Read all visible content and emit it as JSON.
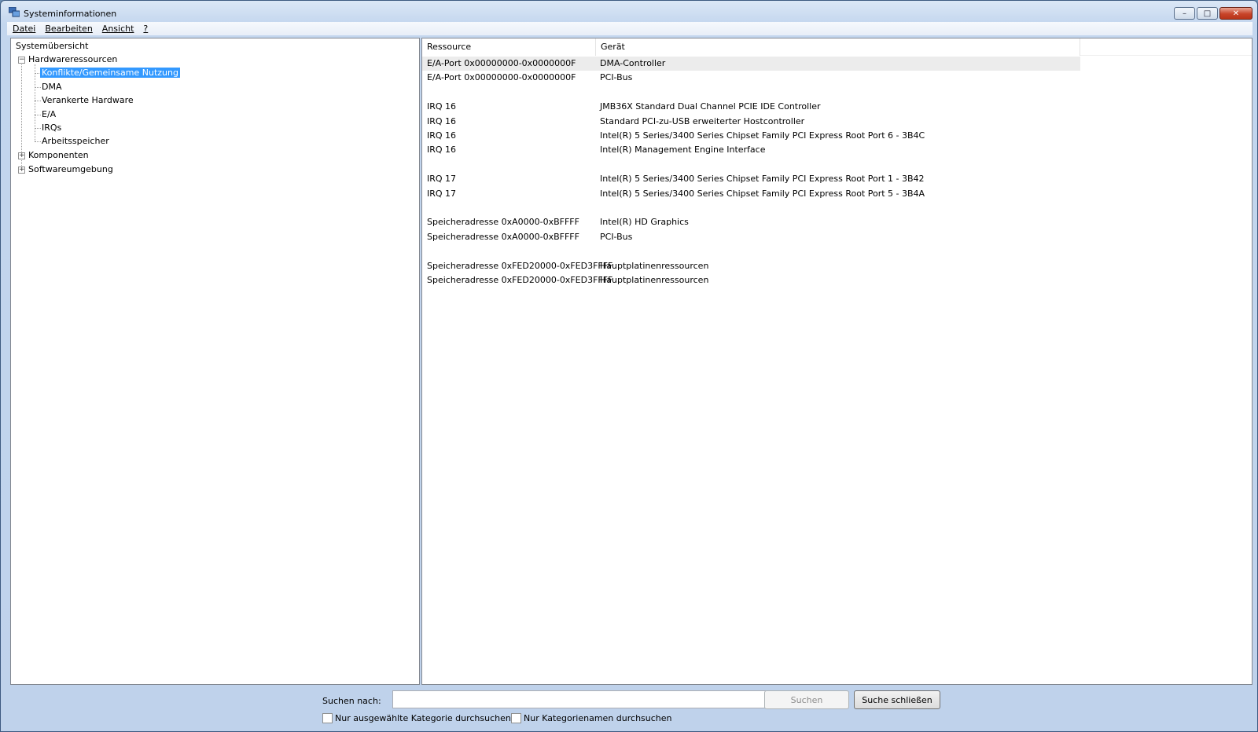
{
  "window": {
    "title": "Systeminformationen",
    "minimize": "–",
    "maximize": "□",
    "close": "✕"
  },
  "menu": [
    "Datei",
    "Bearbeiten",
    "Ansicht",
    "?"
  ],
  "tree": {
    "root": "Systemübersicht",
    "hardware": "Hardwareressourcen",
    "hardware_children": [
      "Konflikte/Gemeinsame Nutzung",
      "DMA",
      "Verankerte Hardware",
      "E/A",
      "IRQs",
      "Arbeitsspeicher"
    ],
    "components": "Komponenten",
    "software": "Softwareumgebung",
    "expanded_sign": "−",
    "collapsed_sign": "+"
  },
  "table": {
    "headers": [
      "Ressource",
      "Gerät"
    ],
    "rows": [
      [
        "E/A-Port 0x00000000-0x0000000F",
        "DMA-Controller"
      ],
      [
        "E/A-Port 0x00000000-0x0000000F",
        "PCI-Bus"
      ],
      [
        "",
        ""
      ],
      [
        "IRQ 16",
        "JMB36X Standard Dual Channel PCIE IDE Controller"
      ],
      [
        "IRQ 16",
        "Standard PCI-zu-USB erweiterter Hostcontroller"
      ],
      [
        "IRQ 16",
        "Intel(R) 5 Series/3400 Series Chipset Family PCI Express Root Port 6 - 3B4C"
      ],
      [
        "IRQ 16",
        "Intel(R) Management Engine Interface"
      ],
      [
        "",
        ""
      ],
      [
        "IRQ 17",
        "Intel(R) 5 Series/3400 Series Chipset Family PCI Express Root Port 1 - 3B42"
      ],
      [
        "IRQ 17",
        "Intel(R) 5 Series/3400 Series Chipset Family PCI Express Root Port 5 - 3B4A"
      ],
      [
        "",
        ""
      ],
      [
        "Speicheradresse 0xA0000-0xBFFFF",
        "Intel(R) HD Graphics"
      ],
      [
        "Speicheradresse 0xA0000-0xBFFFF",
        "PCI-Bus"
      ],
      [
        "",
        ""
      ],
      [
        "Speicheradresse 0xFED20000-0xFED3FFFF",
        "Hauptplatinenressourcen"
      ],
      [
        "Speicheradresse 0xFED20000-0xFED3FFFF",
        "Hauptplatinenressourcen"
      ]
    ]
  },
  "search": {
    "label": "Suchen nach:",
    "value": "",
    "placeholder": "",
    "search_button": "Suchen",
    "close_button": "Suche schließen",
    "option_selected_category": "Nur ausgewählte Kategorie durchsuchen",
    "option_category_names": "Nur Kategorienamen durchsuchen"
  }
}
